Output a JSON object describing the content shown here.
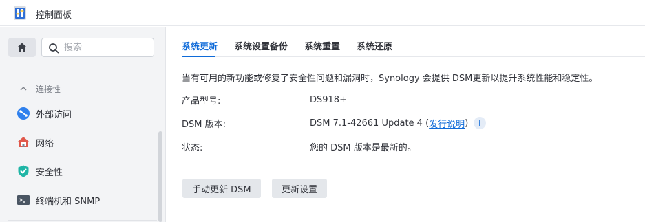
{
  "window": {
    "title": "控制面板",
    "icon": "control-panel-icon"
  },
  "sidebar": {
    "search": {
      "placeholder": "搜索",
      "value": ""
    },
    "group": {
      "label": "连接性",
      "expanded": true
    },
    "items": [
      {
        "label": "外部访问",
        "icon": "external-access-icon",
        "color": "#2f80ed"
      },
      {
        "label": "网络",
        "icon": "network-house-icon",
        "color": "#e0584b"
      },
      {
        "label": "安全性",
        "icon": "shield-check-icon",
        "color": "#1fb5a6"
      },
      {
        "label": "终端机和 SNMP",
        "icon": "terminal-icon",
        "color": "#4a5563"
      }
    ]
  },
  "tabs": [
    {
      "label": "系统更新",
      "active": true
    },
    {
      "label": "系统设置备份",
      "active": false
    },
    {
      "label": "系统重置",
      "active": false
    },
    {
      "label": "系统还原",
      "active": false
    }
  ],
  "update": {
    "description": "当有可用的新功能或修复了安全性问题和漏洞时，Synology 会提供 DSM更新以提升系统性能和稳定性。",
    "model_label": "产品型号:",
    "model_value": "DS918+",
    "version_label": "DSM 版本:",
    "version_value": "DSM 7.1-42661 Update 4",
    "version_paren_open": " (",
    "release_notes_link": "发行说明",
    "version_paren_close": ")",
    "status_label": "状态:",
    "status_value": "您的 DSM 版本是最新的。"
  },
  "buttons": {
    "manual_update": "手动更新 DSM",
    "update_settings": "更新设置"
  },
  "colors": {
    "accent": "#0f6bd9",
    "success": "#1e9e2f"
  }
}
